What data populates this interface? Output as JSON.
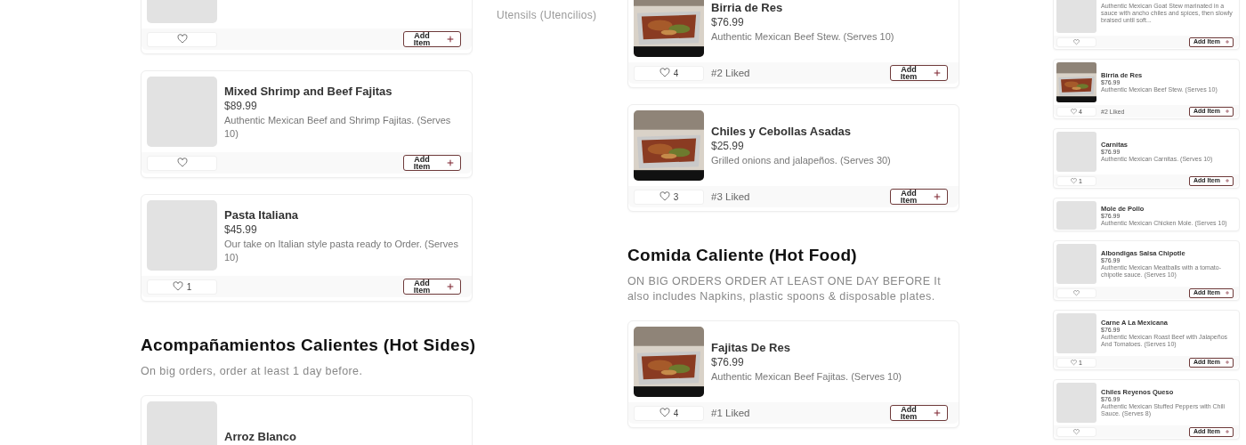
{
  "menu_column": [
    {
      "kind": "item",
      "photo": false,
      "add_label": "Add Item"
    },
    {
      "kind": "item",
      "name": "Mixed Shrimp and Beef Fajitas",
      "price": "$89.99",
      "description": "Authentic Mexican Beef and Shrimp Fajitas. (Serves 10)",
      "photo": false,
      "add_label": "Add Item"
    },
    {
      "kind": "item",
      "name": "Pasta Italiana",
      "price": "$45.99",
      "description": "Our take on Italian style pasta ready to Order. (Serves 10)",
      "photo": false,
      "likes": "1",
      "add_label": "Add Item"
    },
    {
      "kind": "section",
      "title": "Acompañamientos Calientes (Hot Sides)",
      "note": "On big orders, order at least 1 day before."
    },
    {
      "kind": "item",
      "name": "Arroz Blanco",
      "photo": false
    }
  ],
  "sidebar": {
    "items": [
      "Utensils (Utencilios)"
    ]
  },
  "main_column": [
    {
      "kind": "item",
      "name": "Birria de Res",
      "price": "$76.99",
      "description": "Authentic Mexican Beef Stew. (Serves 10)",
      "photo": true,
      "likes": "4",
      "rank": "#2 Liked",
      "add_label": "Add Item"
    },
    {
      "kind": "item",
      "name": "Chiles y Cebollas Asadas",
      "price": "$25.99",
      "description": "Grilled onions and jalapeños. (Serves 30)",
      "photo": true,
      "likes": "3",
      "rank": "#3 Liked",
      "add_label": "Add Item"
    },
    {
      "kind": "section",
      "title": "Comida Caliente (Hot Food)",
      "note": "ON BIG ORDERS ORDER AT LEAST ONE DAY BEFORE It also includes Napkins, plastic spoons & disposable plates."
    },
    {
      "kind": "item",
      "name": "Fajitas De Res",
      "price": "$76.99",
      "description": "Authentic Mexican Beef Fajitas. (Serves 10)",
      "photo": true,
      "likes": "4",
      "rank": "#1 Liked",
      "add_label": "Add Item"
    }
  ],
  "preview_column": [
    {
      "kind": "item",
      "description": "Authentic Mexican Goat Stew marinated in a sauce with ancho chiles and spices, then slowly braised until soft...",
      "photo": false,
      "add_label": "Add Item"
    },
    {
      "kind": "item",
      "name": "Birria de Res",
      "price": "$76.99",
      "description": "Authentic Mexican Beef Stew. (Serves 10)",
      "photo": true,
      "likes": "4",
      "rank": "#2 Liked",
      "add_label": "Add Item"
    },
    {
      "kind": "item",
      "name": "Carnitas",
      "price": "$76.99",
      "description": "Authentic Mexican Carnitas. (Serves 10)",
      "photo": false,
      "likes": "1",
      "add_label": "Add Item"
    },
    {
      "kind": "item",
      "name": "Mole de Pollo",
      "price": "$76.99",
      "description": "Authentic Mexican Chicken Mole. (Serves 10)",
      "photo": false
    },
    {
      "kind": "item",
      "name": "Albondigas Salsa Chipotle",
      "price": "$76.99",
      "description": "Authentic Mexican Meatballs with a tomato-chipotle sauce. (Serves 10)",
      "photo": false,
      "add_label": "Add Item"
    },
    {
      "kind": "item",
      "name": "Carne A La Mexicana",
      "price": "$76.99",
      "description": "Authentic Mexican Roast Beef with Jalapeños And Tomatoes. (Serves 10)",
      "photo": false,
      "likes": "1",
      "add_label": "Add Item"
    },
    {
      "kind": "item",
      "name": "Chiles Reyenos Queso",
      "price": "$76.99",
      "description": "Authentic Mexican Stuffed Peppers with Chili Sauce. (Serves 8)",
      "photo": false,
      "add_label": "Add Item"
    }
  ]
}
